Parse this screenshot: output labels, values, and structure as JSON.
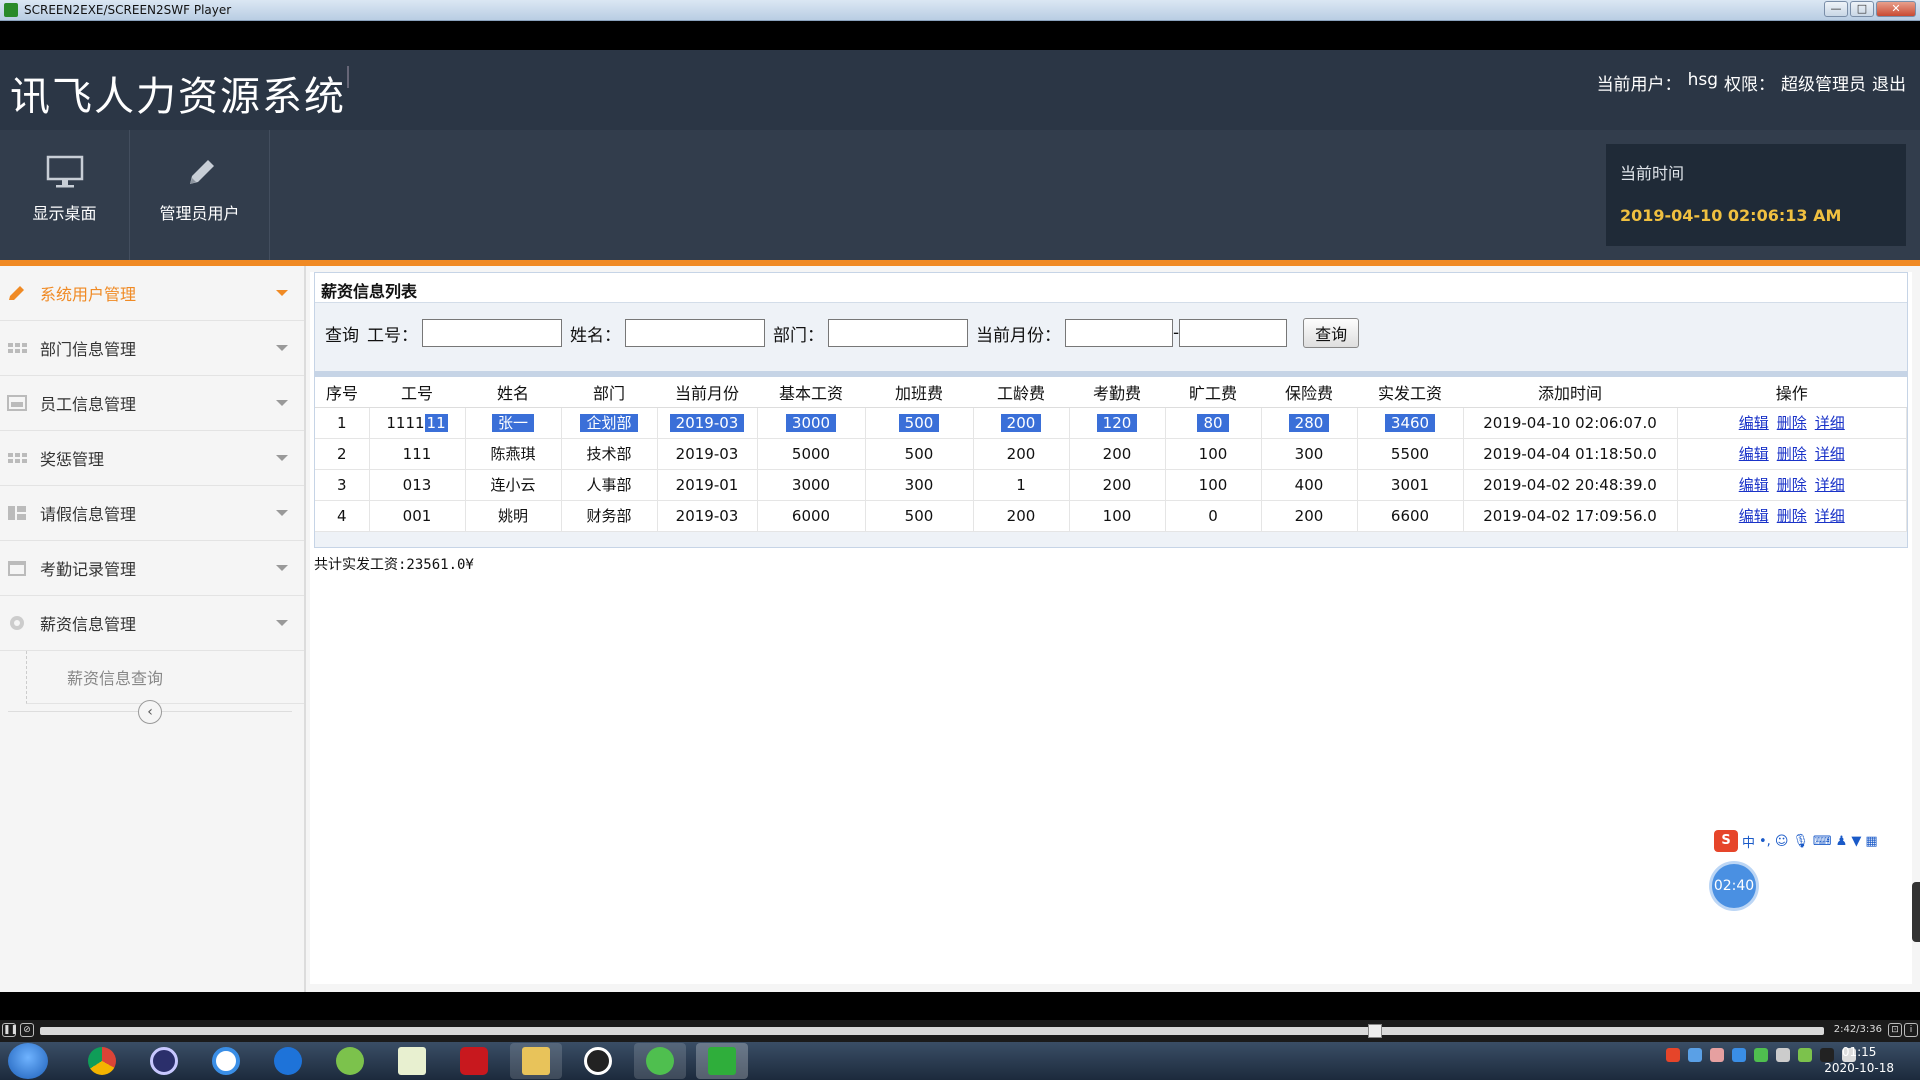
{
  "window": {
    "title": "SCREEN2EXE/SCREEN2SWF Player",
    "minimize": "—",
    "maximize": "□",
    "close": "✕"
  },
  "header": {
    "brand": "讯飞人力资源系统",
    "user_label": "当前用户：",
    "user_name": "hsg",
    "role_label": "权限：",
    "role": "超级管理员",
    "logout": "退出"
  },
  "toolbar": {
    "desktop": "显示桌面",
    "admin": "管理员用户",
    "time_label": "当前时间",
    "time_value": "2019-04-10 02:06:13 AM"
  },
  "sidebar": {
    "items": [
      {
        "label": "系统用户管理",
        "icon": "pencil-icon",
        "active": true
      },
      {
        "label": "部门信息管理",
        "icon": "grid-icon"
      },
      {
        "label": "员工信息管理",
        "icon": "image-icon"
      },
      {
        "label": "奖惩管理",
        "icon": "grid-icon"
      },
      {
        "label": "请假信息管理",
        "icon": "list-icon"
      },
      {
        "label": "考勤记录管理",
        "icon": "calendar-icon"
      },
      {
        "label": "薪资信息管理",
        "icon": "gear-icon"
      }
    ],
    "sub_item": "薪资信息查询",
    "collapse": "‹"
  },
  "panel": {
    "title": "薪资信息列表",
    "search_label": "查询",
    "field_id": "工号：",
    "field_name": "姓名：",
    "field_dept": "部门：",
    "field_month": "当前月份：",
    "query_button": "查询",
    "range_sep": "-"
  },
  "table": {
    "headers": [
      "序号",
      "工号",
      "姓名",
      "部门",
      "当前月份",
      "基本工资",
      "加班费",
      "工龄费",
      "考勤费",
      "旷工费",
      "保险费",
      "实发工资",
      "添加时间",
      "操作"
    ],
    "rows": [
      [
        "1",
        "1111",
        "11",
        "张一",
        "企划部",
        "2019-03",
        "3000",
        "500",
        "200",
        "120",
        "80",
        "280",
        "3460",
        "2019-04-10 02:06:07.0"
      ],
      [
        "2",
        "111",
        "",
        "陈燕琪",
        "技术部",
        "2019-03",
        "5000",
        "500",
        "200",
        "200",
        "100",
        "300",
        "5500",
        "2019-04-04 01:18:50.0"
      ],
      [
        "3",
        "013",
        "",
        "连小云",
        "人事部",
        "2019-01",
        "3000",
        "300",
        "1",
        "200",
        "100",
        "400",
        "3001",
        "2019-04-02 20:48:39.0"
      ],
      [
        "4",
        "001",
        "",
        "姚明",
        "财务部",
        "2019-03",
        "6000",
        "500",
        "200",
        "100",
        "0",
        "200",
        "6600",
        "2019-04-02 17:09:56.0"
      ]
    ],
    "actions": [
      "编辑",
      "删除",
      "详细"
    ]
  },
  "total": "共计实发工资:23561.0¥",
  "overlay": {
    "timer": "02:40",
    "ime_lang": "中"
  },
  "player": {
    "time": "2:42/3:36"
  },
  "taskbar": {
    "clock_time": "01:15",
    "clock_date": "2020-10-18"
  }
}
